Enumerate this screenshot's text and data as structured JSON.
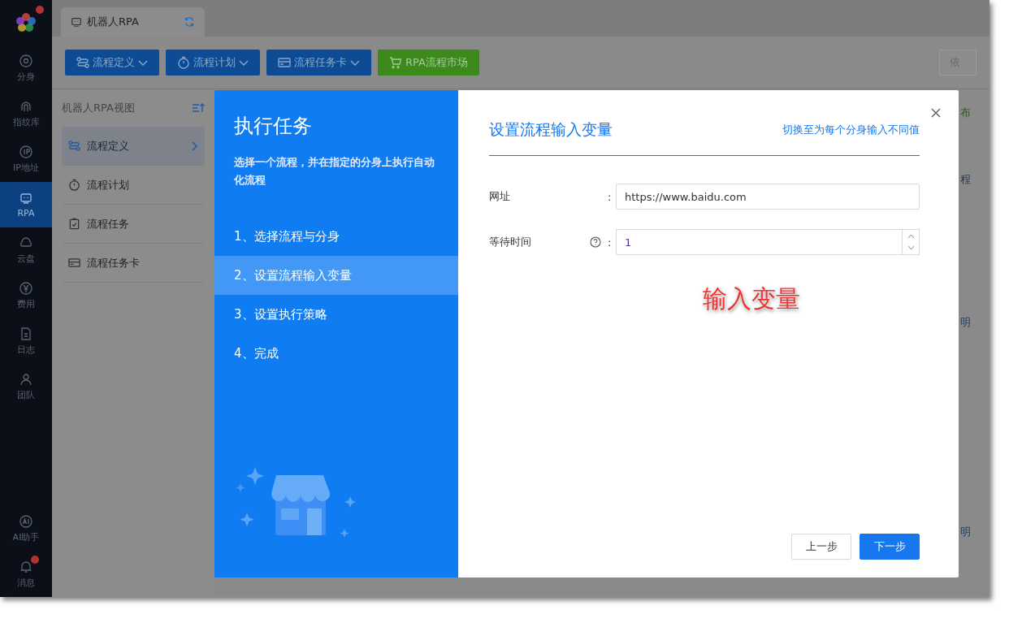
{
  "app": {
    "logo_badge": true
  },
  "nav": [
    {
      "label": "分身",
      "selected": false,
      "badge": false
    },
    {
      "label": "指纹库",
      "selected": false,
      "badge": false
    },
    {
      "label": "IP地址",
      "selected": false,
      "badge": false
    },
    {
      "label": "RPA",
      "selected": true,
      "badge": false
    },
    {
      "label": "云盘",
      "selected": false,
      "badge": false
    },
    {
      "label": "费用",
      "selected": false,
      "badge": false
    },
    {
      "label": "日志",
      "selected": false,
      "badge": false
    },
    {
      "label": "团队",
      "selected": false,
      "badge": false
    }
  ],
  "nav_bottom": [
    {
      "label": "AI助手",
      "selected": false,
      "badge": false
    },
    {
      "label": "消息",
      "selected": false,
      "badge": true
    }
  ],
  "tab": {
    "label": "机器人RPA"
  },
  "toolbar": [
    {
      "label": "流程定义",
      "kind": "dropdown"
    },
    {
      "label": "流程计划",
      "kind": "dropdown"
    },
    {
      "label": "流程任务卡",
      "kind": "dropdown"
    },
    {
      "label": "RPA流程市场",
      "kind": "market"
    }
  ],
  "toolbar_right": {
    "label": "依"
  },
  "panel": {
    "title": "机器人RPA视图",
    "items": [
      {
        "label": "流程定义",
        "selected": true
      },
      {
        "label": "流程计划",
        "selected": false
      },
      {
        "label": "流程任务",
        "selected": false
      },
      {
        "label": "流程任务卡",
        "selected": false
      }
    ]
  },
  "background_fragments": [
    "布",
    "程",
    "明",
    "明"
  ],
  "dialog": {
    "title": "执行任务",
    "description": "选择一个流程，并在指定的分身上执行自动化流程",
    "steps": [
      {
        "label": "1、选择流程与分身",
        "selected": false
      },
      {
        "label": "2、设置流程输入变量",
        "selected": true
      },
      {
        "label": "3、设置执行策略",
        "selected": false
      },
      {
        "label": "4、完成",
        "selected": false
      }
    ],
    "heading": "设置流程输入变量",
    "switch_link": "切换至为每个分身输入不同值",
    "fields": [
      {
        "label": "网址",
        "kind": "text",
        "value": "https://www.baidu.com",
        "help": false,
        "colon": ":"
      },
      {
        "label": "等待时间",
        "kind": "number",
        "value": "1",
        "help": true,
        "colon": ":"
      }
    ],
    "annotation": "输入变量",
    "buttons": [
      {
        "label": "上一步",
        "primary": false
      },
      {
        "label": "下一步",
        "primary": true
      }
    ]
  }
}
